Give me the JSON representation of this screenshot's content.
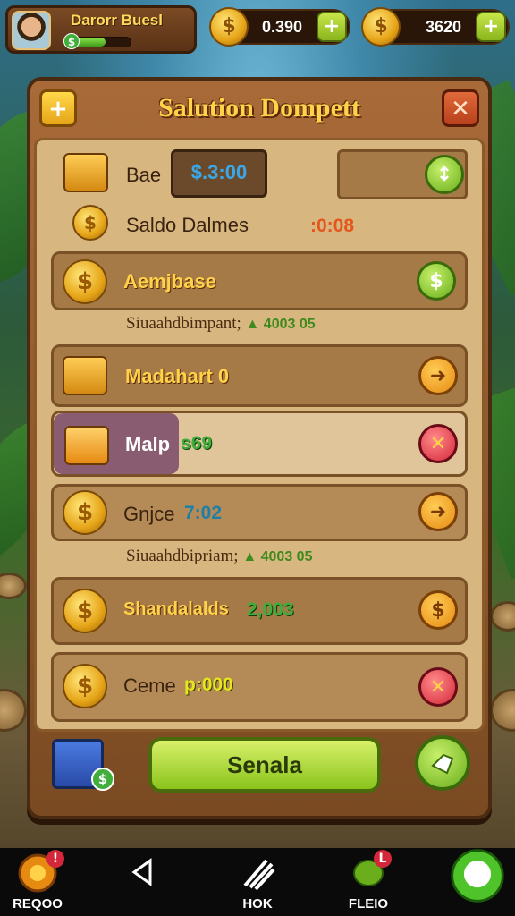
{
  "profile": {
    "name": "Darorr Buesl",
    "xp_fraction": 0.6
  },
  "currencies": [
    {
      "value": "0.390",
      "coin_symbol": "$",
      "plus": "+"
    },
    {
      "value": "3620",
      "coin_symbol": "$",
      "plus": "+"
    }
  ],
  "panel": {
    "title": "Salution Dompett",
    "left_button": "+",
    "close_button": "✕"
  },
  "balance_row": {
    "label": "Bae",
    "value": "$.3:00",
    "action": "↕"
  },
  "balance_sub": {
    "label": "Saldo Dalmes",
    "value": ":0:08"
  },
  "rows": [
    {
      "label": "Aemjbase",
      "value": "",
      "action": "$"
    },
    {
      "label": "Madahart 0",
      "value": "",
      "action": "➜"
    },
    {
      "label": "Malp",
      "value": "s69",
      "action": "✕"
    },
    {
      "label": "Gnjce",
      "value": "7:02",
      "action": "➜"
    },
    {
      "label": "Shandalalds",
      "value": "2,003",
      "action": "$"
    },
    {
      "label": "Ceme",
      "value": "p:000",
      "action": "✕"
    }
  ],
  "sub_lines": [
    {
      "text": "Siuaahdbimpant;",
      "delta": "▲ 4003 05"
    },
    {
      "text": "Siuaahdbipriam;",
      "delta": "▲ 4003 05"
    }
  ],
  "footer": {
    "main_button": "Senala",
    "gift_dollar": "$"
  },
  "bottom_nav": [
    {
      "label": "REQOO",
      "badge": "!"
    },
    {
      "label": ""
    },
    {
      "label": "HOK"
    },
    {
      "label": "FLEIO",
      "badge": "L"
    },
    {
      "label": ""
    }
  ]
}
